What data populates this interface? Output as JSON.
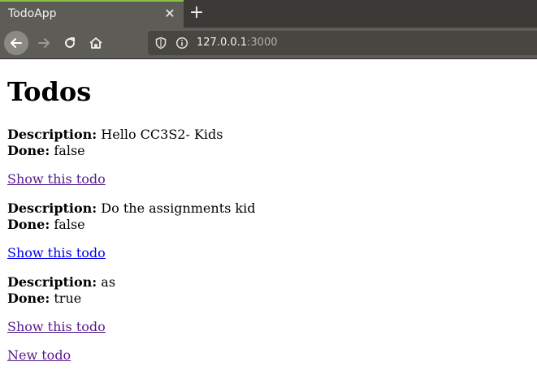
{
  "browser": {
    "tab_title": "TodoApp",
    "url_host": "127.0.0.1",
    "url_port": ":3000"
  },
  "page": {
    "heading": "Todos",
    "description_label": "Description:",
    "done_label": "Done:",
    "todos": [
      {
        "description": "Hello CC3S2- Kids",
        "done": "false",
        "link": "Show this todo"
      },
      {
        "description": "Do the assignments kid",
        "done": "false",
        "link": "Show this todo"
      },
      {
        "description": "as",
        "done": "true",
        "link": "Show this todo"
      }
    ],
    "new_link": "New todo"
  }
}
